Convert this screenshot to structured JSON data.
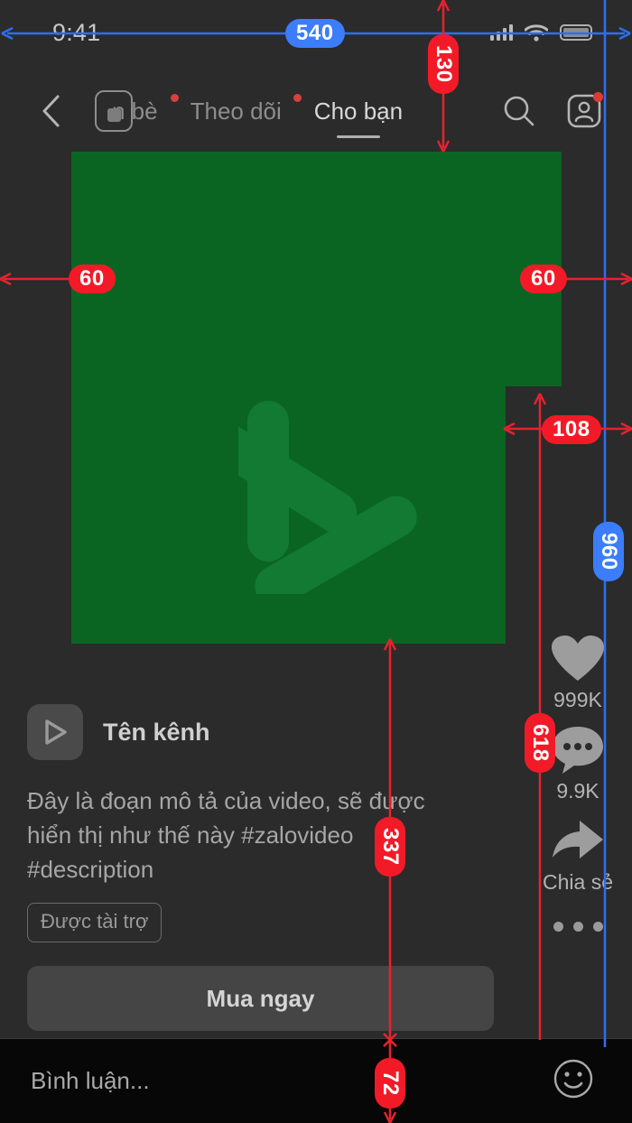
{
  "status_bar": {
    "time": "9:41",
    "icons": [
      "signal-icon",
      "wifi-icon",
      "battery-icon"
    ]
  },
  "top_nav": {
    "back_icon": "chevron-left-icon",
    "overlay_icon": "square-placeholder-icon",
    "tabs": [
      {
        "label": "n bè",
        "active": false,
        "dot": false
      },
      {
        "label": "Theo dõi",
        "active": false,
        "dot": true
      },
      {
        "label": "Cho bạn",
        "active": true,
        "dot": false
      }
    ],
    "right_icons": [
      {
        "name": "search-icon",
        "badge": false
      },
      {
        "name": "contacts-icon",
        "badge": true
      }
    ]
  },
  "video": {
    "placeholder_color": "#0a6522",
    "logo_icon": "play-triangle-logo"
  },
  "info": {
    "channel_avatar_icon": "play-icon",
    "channel_name": "Tên kênh",
    "description": "Đây là đoạn mô tả của video, sẽ được hiển thị như thế này #zalovideo #description",
    "sponsored_label": "Được tài trợ",
    "cta_label": "Mua ngay"
  },
  "actions": [
    {
      "icon": "heart-icon",
      "label": "999K"
    },
    {
      "icon": "comment-icon",
      "label": "9.9K"
    },
    {
      "icon": "share-icon",
      "label": "Chia sẻ"
    },
    {
      "icon": "more-icon",
      "label": ""
    }
  ],
  "comment_bar": {
    "placeholder": "Bình luận...",
    "emoji_icon": "smiley-face-icon"
  },
  "measurements": {
    "colors": {
      "blue": "#3b7dfb",
      "red": "#f31a28"
    },
    "width_540": "540",
    "top_130": "130",
    "left_60": "60",
    "right_60": "60",
    "inset_108": "108",
    "height_960": "960",
    "rail_618": "618",
    "info_337": "337",
    "bottom_72": "72"
  }
}
